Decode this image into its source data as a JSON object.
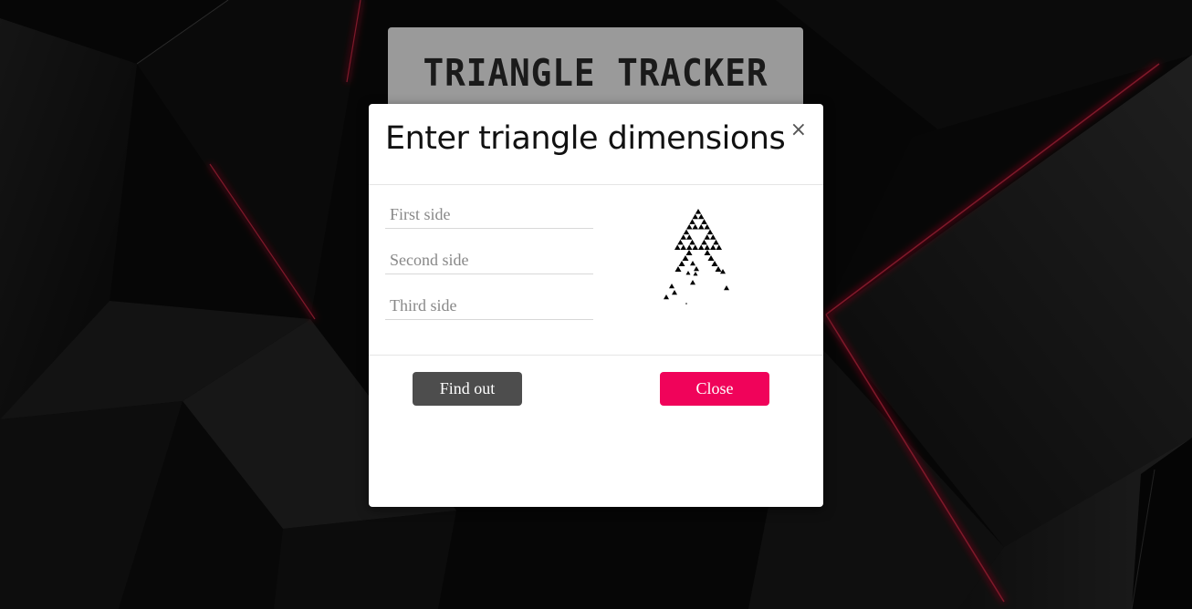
{
  "page": {
    "title": "TRIANGLE TRACKER"
  },
  "modal": {
    "title": "Enter triangle dimensions",
    "close_icon_glyph": "×",
    "fields": {
      "first_placeholder": "First side",
      "first_value": "",
      "second_placeholder": "Second side",
      "second_value": "",
      "third_placeholder": "Third side",
      "third_value": ""
    },
    "illustration_icon": "sierpinski-triangle-icon",
    "buttons": {
      "find_out": "Find out",
      "close": "Close"
    }
  },
  "colors": {
    "accent_pink": "#f0035a",
    "button_dark": "#4d4d4d",
    "title_card_bg": "#9a9a9a"
  }
}
